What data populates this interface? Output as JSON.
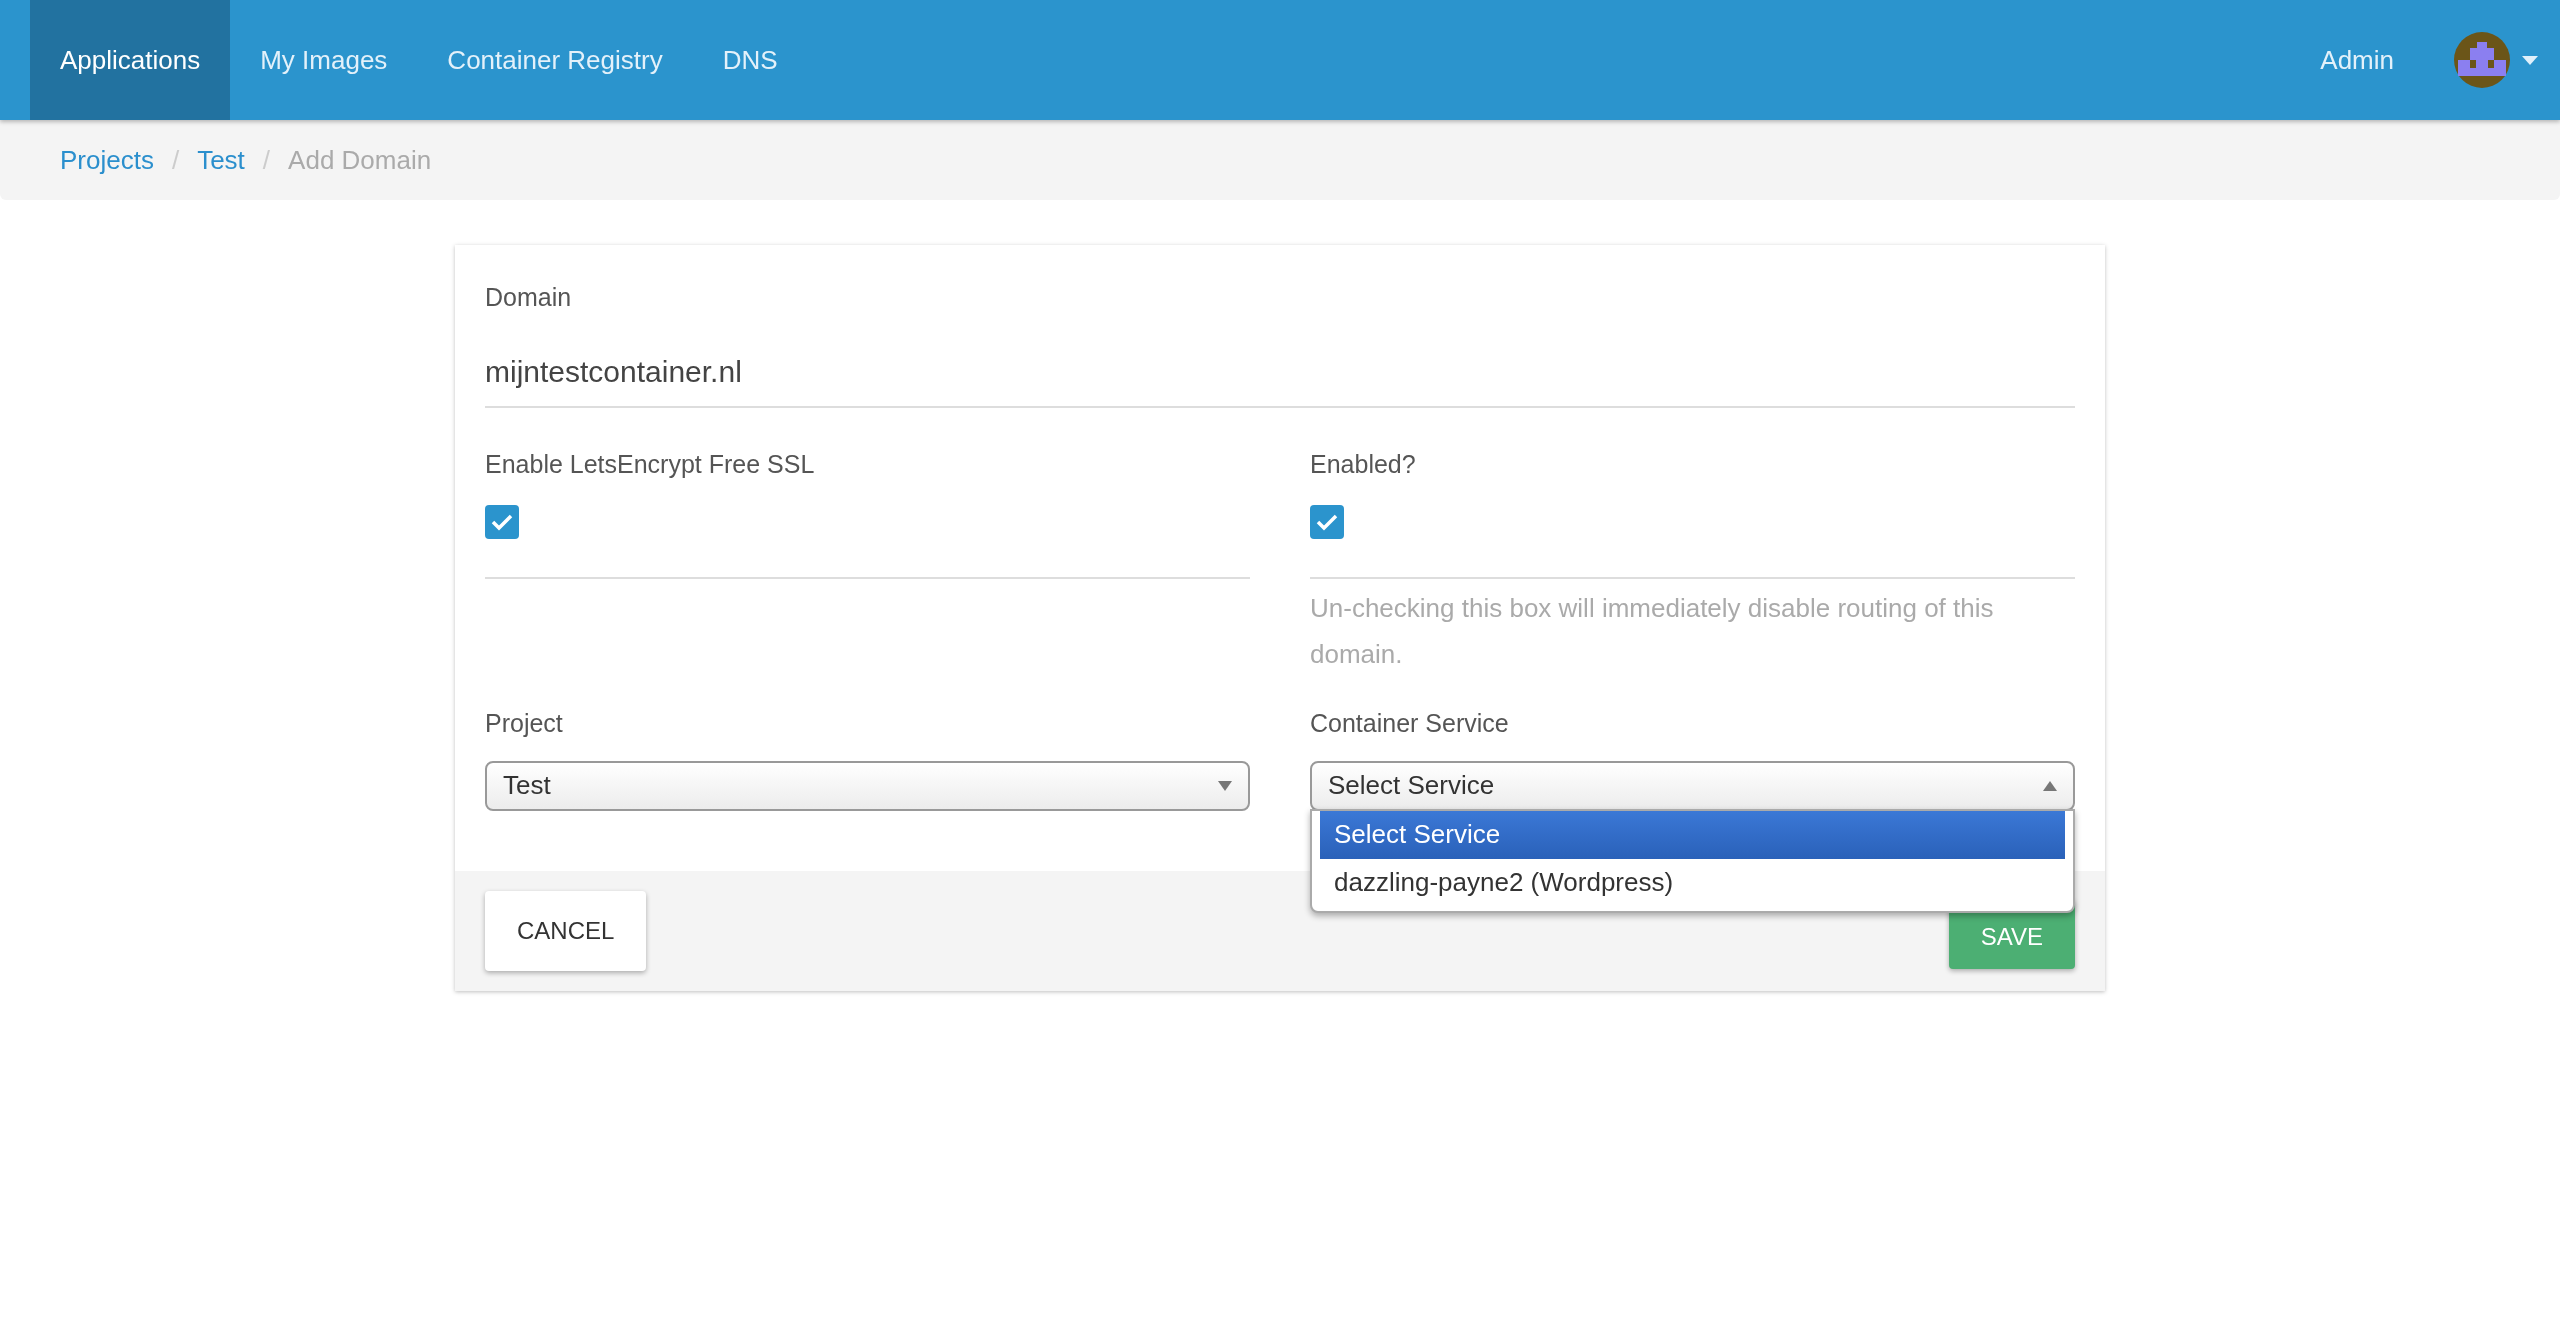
{
  "navbar": {
    "tabs": [
      {
        "label": "Applications",
        "selected": true
      },
      {
        "label": "My Images",
        "selected": false
      },
      {
        "label": "Container Registry",
        "selected": false
      },
      {
        "label": "DNS",
        "selected": false
      }
    ],
    "user": {
      "label": "Admin"
    }
  },
  "breadcrumb": [
    {
      "label": "Projects",
      "current": false,
      "separator": "/"
    },
    {
      "label": "Test",
      "current": false,
      "separator": "/"
    },
    {
      "label": "Add Domain",
      "current": true
    }
  ],
  "form": {
    "domain": {
      "label": "Domain",
      "value": "mijntestcontainer.nl"
    },
    "ssl": {
      "label": "Enable LetsEncrypt Free SSL",
      "checked": true
    },
    "enabled": {
      "label": "Enabled?",
      "checked": true,
      "help": "Un-checking this box will immediately disable routing of this domain."
    },
    "project": {
      "label": "Project",
      "value": "Test"
    },
    "service": {
      "label": "Container Service",
      "value": "Select Service",
      "expanded": true,
      "options": [
        {
          "label": "Select Service",
          "selected": true
        },
        {
          "label": "dazzling-payne2 (Wordpress)",
          "selected": false
        }
      ]
    }
  },
  "buttons": [
    {
      "label": "CANCEL",
      "kind": "cancel"
    },
    {
      "label": "SAVE",
      "kind": "save"
    }
  ]
}
